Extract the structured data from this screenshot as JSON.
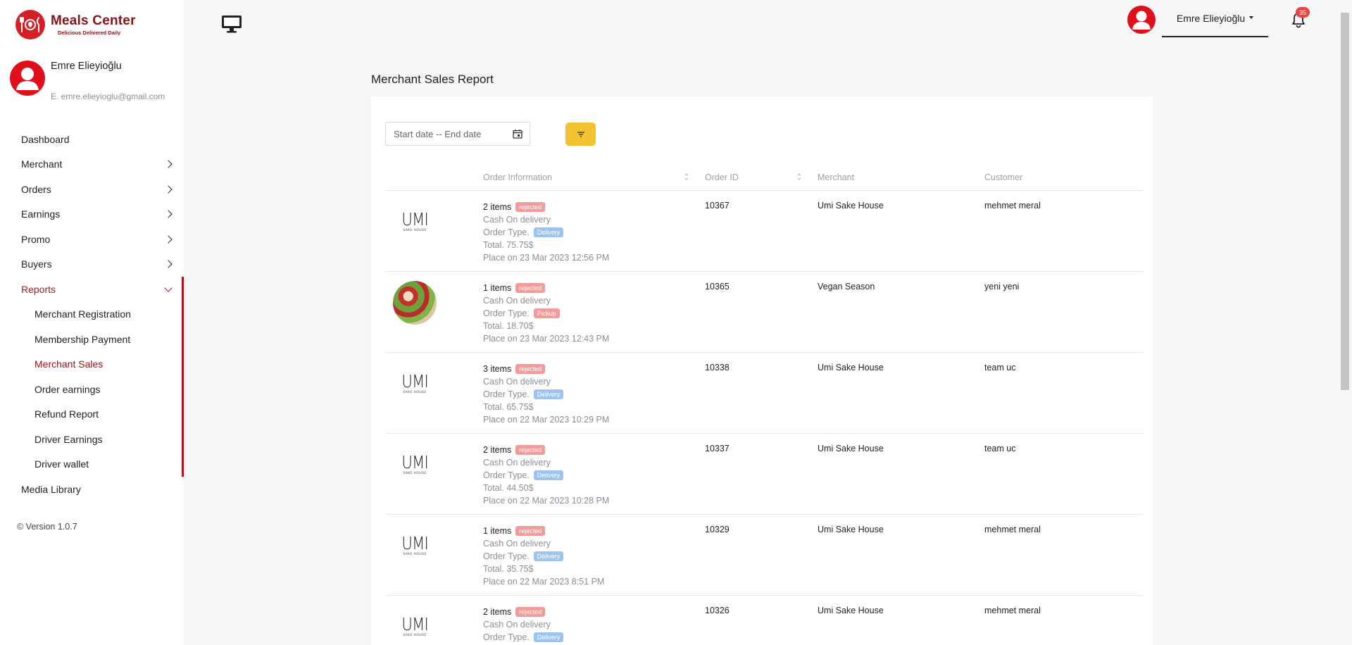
{
  "brand": {
    "title": "Meals Center",
    "tagline": "Delicious Delivered Daily"
  },
  "profile": {
    "name": "Emre Elieyioğlu",
    "email": "E. emre.elieyioglu@gmail.com"
  },
  "nav": {
    "dashboard": "Dashboard",
    "merchant": "Merchant",
    "orders": "Orders",
    "earnings": "Earnings",
    "promo": "Promo",
    "buyers": "Buyers",
    "reports": "Reports",
    "reports_sub": [
      "Merchant Registration",
      "Membership Payment",
      "Merchant Sales",
      "Order earnings",
      "Refund Report",
      "Driver Earnings",
      "Driver wallet"
    ],
    "media_library": "Media Library"
  },
  "version": "© Version 1.0.7",
  "topbar": {
    "user": "Emre Elieyioğlu",
    "notifications": "35"
  },
  "page": {
    "title": "Merchant Sales Report"
  },
  "filter": {
    "date_placeholder": "Start date -- End date"
  },
  "table": {
    "columns": [
      "Order Information",
      "Order ID",
      "Merchant",
      "Customer"
    ],
    "rows": [
      {
        "image": "umi",
        "items": "2 items",
        "status": "rejected",
        "payment": "Cash On delivery",
        "order_type_label": "Order Type.",
        "order_type": "Delivery",
        "total": "Total. 75.75$",
        "placed": "Place on 23 Mar 2023 12:56 PM",
        "order_id": "10367",
        "merchant": "Umi Sake House",
        "customer": "mehmet meral"
      },
      {
        "image": "salad",
        "items": "1 items",
        "status": "rejected",
        "payment": "Cash On delivery",
        "order_type_label": "Order Type.",
        "order_type": "Pickup",
        "total": "Total. 18.70$",
        "placed": "Place on 23 Mar 2023 12:43 PM",
        "order_id": "10365",
        "merchant": "Vegan Season",
        "customer": "yeni yeni"
      },
      {
        "image": "umi",
        "items": "3 items",
        "status": "rejected",
        "payment": "Cash On delivery",
        "order_type_label": "Order Type.",
        "order_type": "Delivery",
        "total": "Total. 65.75$",
        "placed": "Place on 22 Mar 2023 10:29 PM",
        "order_id": "10338",
        "merchant": "Umi Sake House",
        "customer": "team uc"
      },
      {
        "image": "umi",
        "items": "2 items",
        "status": "rejected",
        "payment": "Cash On delivery",
        "order_type_label": "Order Type.",
        "order_type": "Delivery",
        "total": "Total. 44.50$",
        "placed": "Place on 22 Mar 2023 10:28 PM",
        "order_id": "10337",
        "merchant": "Umi Sake House",
        "customer": "team uc"
      },
      {
        "image": "umi",
        "items": "1 items",
        "status": "rejected",
        "payment": "Cash On delivery",
        "order_type_label": "Order Type.",
        "order_type": "Delivery",
        "total": "Total. 35.75$",
        "placed": "Place on 22 Mar 2023 8:51 PM",
        "order_id": "10329",
        "merchant": "Umi Sake House",
        "customer": "mehmet meral"
      },
      {
        "image": "umi",
        "items": "2 items",
        "status": "rejected",
        "payment": "Cash On delivery",
        "order_type_label": "Order Type.",
        "order_type": "Delivery",
        "order_id": "10326",
        "merchant": "Umi Sake House",
        "customer": "mehmet meral"
      }
    ]
  },
  "umi_logo": {
    "word": "UMI",
    "sub": "SAKE HOUSE"
  },
  "colors": {
    "brand_red": "#d31f26",
    "accent_yellow": "#f2c230",
    "rejected": "#f39b9b",
    "delivery": "#9dc4f0"
  }
}
